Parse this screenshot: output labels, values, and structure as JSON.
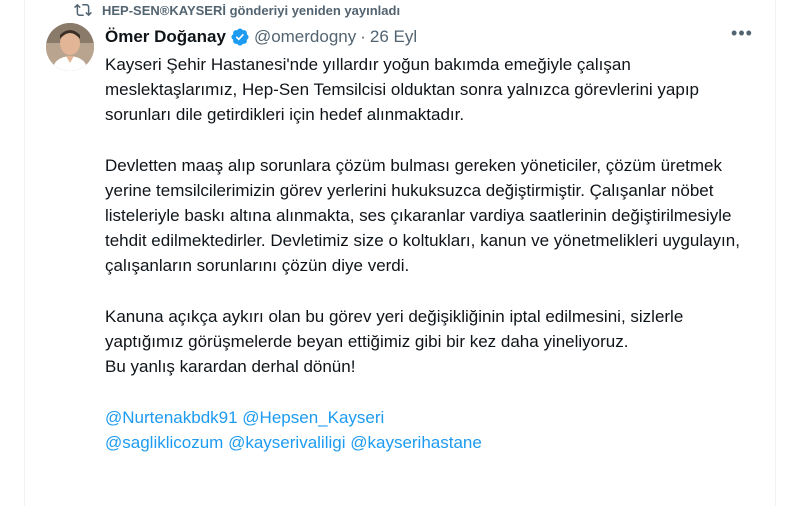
{
  "retweet": {
    "label": "HEP-SEN®KAYSERİ gönderiyi yeniden yayınladı",
    "icon": "retweet-icon"
  },
  "author": {
    "name": "Ömer Doğanay",
    "handle": "@omerdogny",
    "separator": "·",
    "date": "26 Eyl",
    "verified_color": "#1d9bf0",
    "avatar_icon": "avatar-photo"
  },
  "more": {
    "label": "•••"
  },
  "paragraphs": [
    "Kayseri Şehir Hastanesi'nde yıllardır yoğun bakımda emeğiyle çalışan meslektaşlarımız, Hep-Sen Temsilcisi olduktan sonra yalnızca görevlerini yapıp sorunları dile getirdikleri için hedef alınmaktadır.",
    "Devletten maaş alıp sorunlara çözüm bulması gereken yöneticiler, çözüm üretmek yerine temsilcilerimizin görev yerlerini hukuksuzca değiştirmiştir. Çalışanlar nöbet listeleriyle baskı altına alınmakta, ses çıkaranlar vardiya saatlerinin değiştirilmesiyle tehdit edilmektedirler. Devletimiz size o koltukları, kanun ve yönetmelikleri uygulayın, çalışanların sorunlarını çözün diye verdi.",
    "Kanuna açıkça aykırı olan bu görev yeri değişikliğinin iptal edilmesini, sizlerle yaptığımız görüşmelerde beyan ettiğimiz gibi bir kez daha yineliyoruz.",
    "Bu yanlış karardan derhal dönün!"
  ],
  "mentions": {
    "line1": [
      "@Nurtenakbdk91",
      "@Hepsen_Kayseri"
    ],
    "line2": [
      "@sagliklicozum",
      "@kayserivaliligi",
      "@kayserihastane"
    ],
    "color": "#1d9bf0"
  }
}
